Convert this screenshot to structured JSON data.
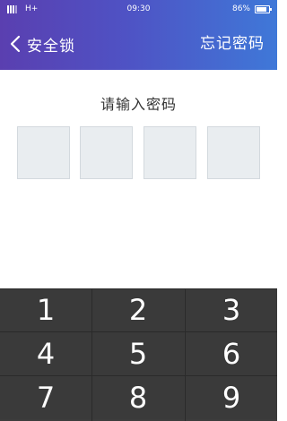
{
  "status_bar": {
    "network": "H+",
    "time": "09:30",
    "battery": "86%"
  },
  "title_bar": {
    "back_label": "安全锁",
    "forgot_label": "忘记密码"
  },
  "prompt": "请输入密码",
  "keypad": {
    "keys": [
      "1",
      "2",
      "3",
      "4",
      "5",
      "6",
      "7",
      "8",
      "9"
    ]
  },
  "colors": {
    "header_start": "#5a3fb0",
    "header_end": "#3f78d8",
    "keypad_bg": "#3a3a3a",
    "pin_box": "#e9edf0"
  }
}
